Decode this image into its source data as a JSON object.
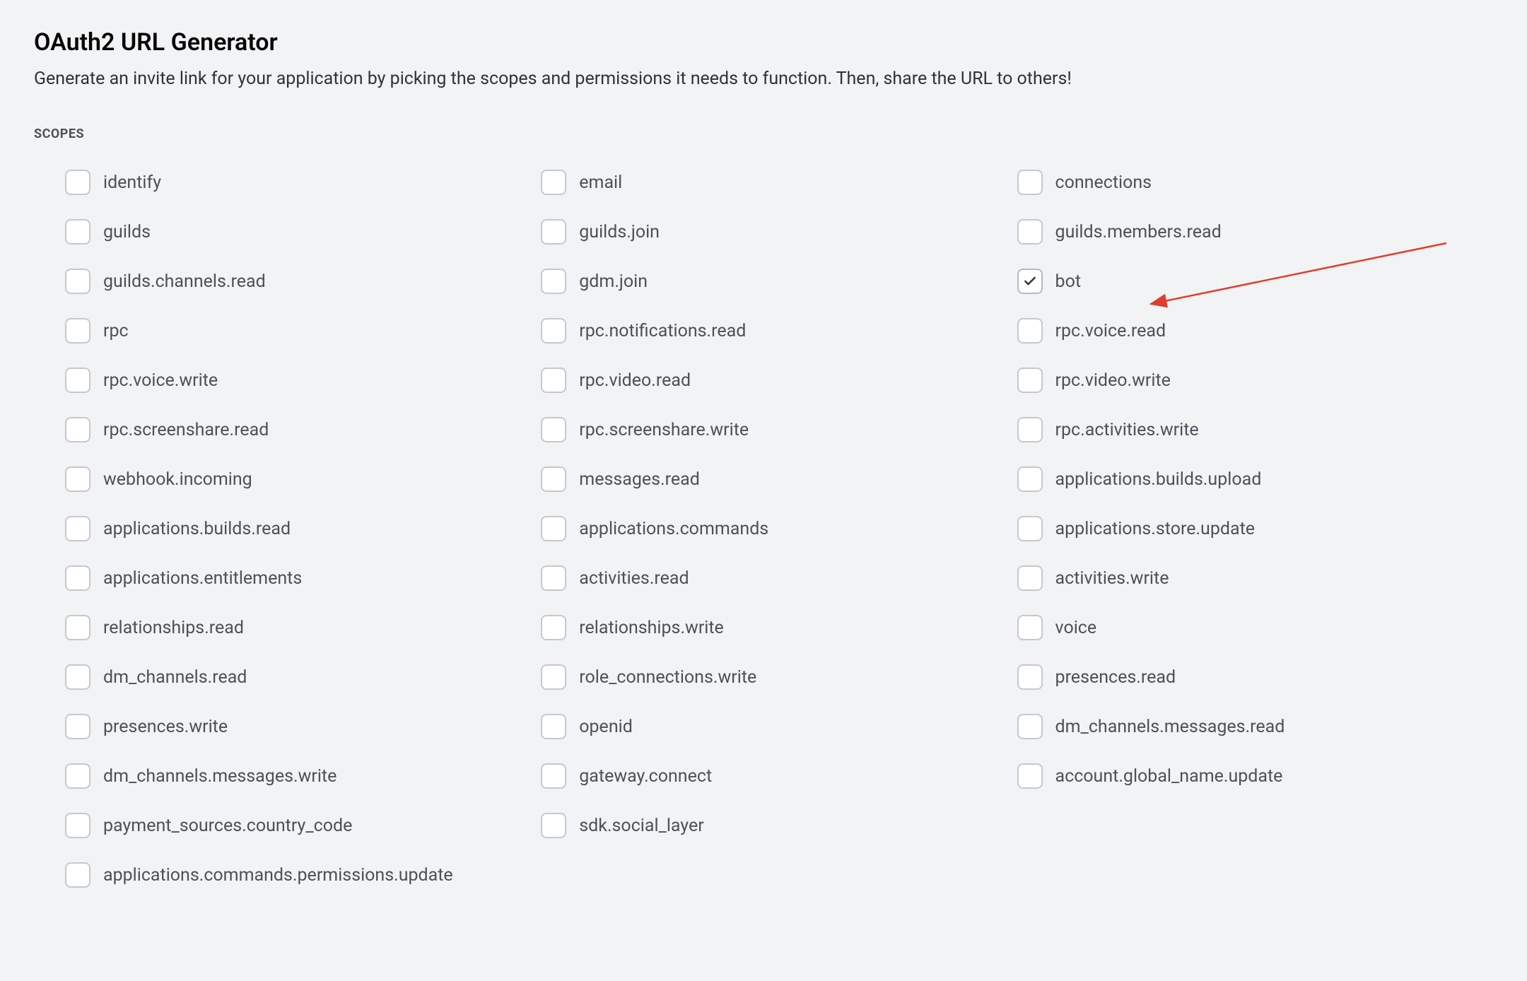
{
  "title": "OAuth2 URL Generator",
  "subtitle": "Generate an invite link for your application by picking the scopes and permissions it needs to function. Then, share the URL to others!",
  "section_label": "SCOPES",
  "scopes": {
    "col1": [
      {
        "label": "identify",
        "checked": false
      },
      {
        "label": "guilds",
        "checked": false
      },
      {
        "label": "guilds.channels.read",
        "checked": false
      },
      {
        "label": "rpc",
        "checked": false
      },
      {
        "label": "rpc.voice.write",
        "checked": false
      },
      {
        "label": "rpc.screenshare.read",
        "checked": false
      },
      {
        "label": "webhook.incoming",
        "checked": false
      },
      {
        "label": "applications.builds.read",
        "checked": false
      },
      {
        "label": "applications.entitlements",
        "checked": false
      },
      {
        "label": "relationships.read",
        "checked": false
      },
      {
        "label": "dm_channels.read",
        "checked": false
      },
      {
        "label": "presences.write",
        "checked": false
      },
      {
        "label": "dm_channels.messages.write",
        "checked": false
      },
      {
        "label": "payment_sources.country_code",
        "checked": false
      }
    ],
    "col2": [
      {
        "label": "email",
        "checked": false
      },
      {
        "label": "guilds.join",
        "checked": false
      },
      {
        "label": "gdm.join",
        "checked": false
      },
      {
        "label": "rpc.notifications.read",
        "checked": false
      },
      {
        "label": "rpc.video.read",
        "checked": false
      },
      {
        "label": "rpc.screenshare.write",
        "checked": false
      },
      {
        "label": "messages.read",
        "checked": false
      },
      {
        "label": "applications.commands",
        "checked": false
      },
      {
        "label": "activities.read",
        "checked": false
      },
      {
        "label": "relationships.write",
        "checked": false
      },
      {
        "label": "role_connections.write",
        "checked": false
      },
      {
        "label": "openid",
        "checked": false
      },
      {
        "label": "gateway.connect",
        "checked": false
      },
      {
        "label": "sdk.social_layer",
        "checked": false
      }
    ],
    "col3": [
      {
        "label": "connections",
        "checked": false
      },
      {
        "label": "guilds.members.read",
        "checked": false
      },
      {
        "label": "bot",
        "checked": true
      },
      {
        "label": "rpc.voice.read",
        "checked": false
      },
      {
        "label": "rpc.video.write",
        "checked": false
      },
      {
        "label": "rpc.activities.write",
        "checked": false
      },
      {
        "label": "applications.builds.upload",
        "checked": false
      },
      {
        "label": "applications.store.update",
        "checked": false
      },
      {
        "label": "activities.write",
        "checked": false
      },
      {
        "label": "voice",
        "checked": false
      },
      {
        "label": "presences.read",
        "checked": false
      },
      {
        "label": "dm_channels.messages.read",
        "checked": false
      },
      {
        "label": "account.global_name.update",
        "checked": false
      }
    ],
    "full_row": {
      "label": "applications.commands.permissions.update",
      "checked": false
    }
  }
}
